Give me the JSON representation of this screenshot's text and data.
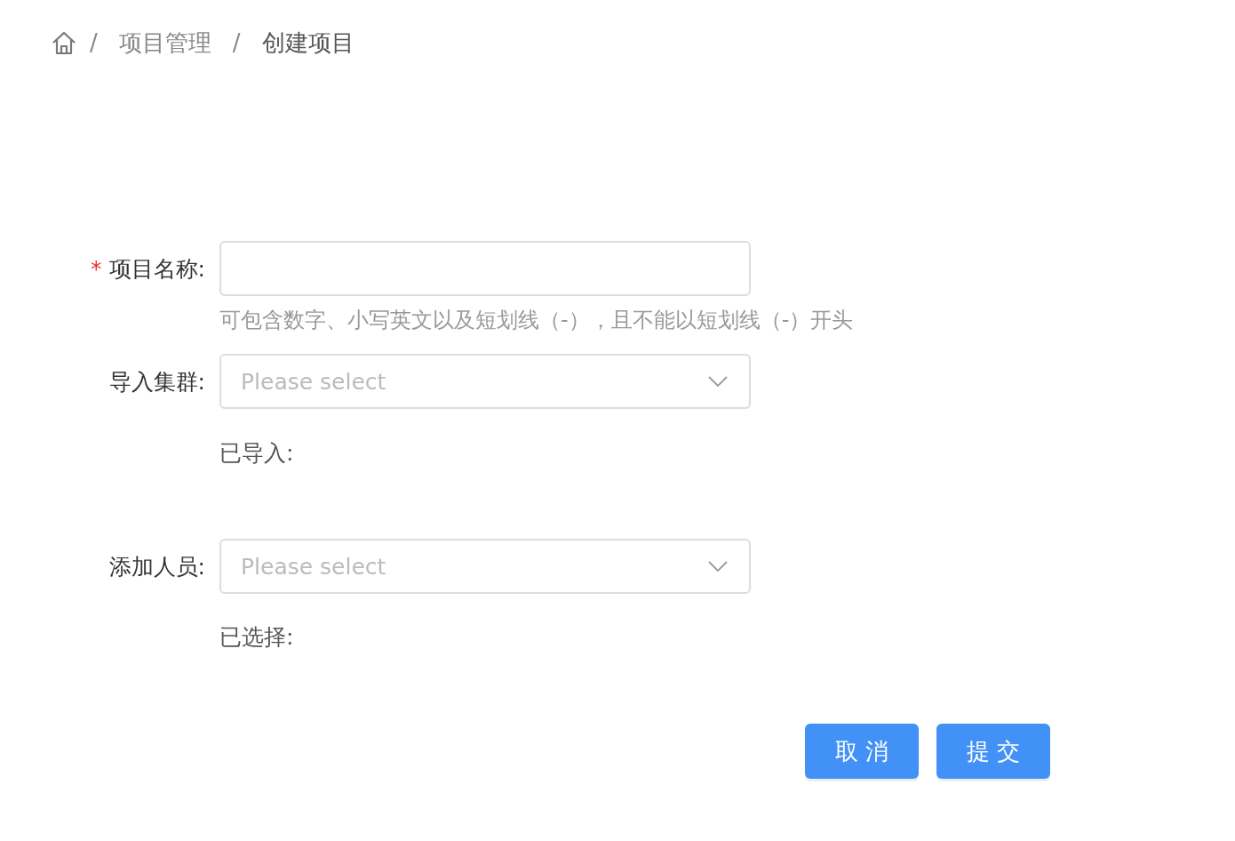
{
  "breadcrumb": [
    {
      "label": "项目管理",
      "current": false
    },
    {
      "label": "创建项目",
      "current": true
    }
  ],
  "breadcrumb_separator": "/",
  "required_mark": "*",
  "form": {
    "fields": [
      {
        "kind": "text",
        "label": "项目名称:",
        "required": true,
        "hint": "可包含数字、小写英文以及短划线（-），且不能以短划线（-）开头"
      },
      {
        "kind": "select",
        "label": "导入集群:",
        "required": false,
        "placeholder": "Please select",
        "note": "已导入:"
      },
      {
        "kind": "select",
        "label": "添加人员:",
        "required": false,
        "placeholder": "Please select",
        "note": "已选择:"
      }
    ]
  },
  "buttons": [
    "取消",
    "提交"
  ]
}
